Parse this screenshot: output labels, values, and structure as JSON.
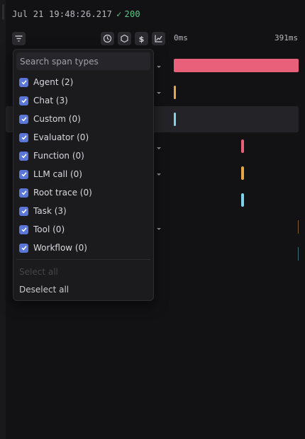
{
  "header": {
    "timestamp": "Jul 21 19:48:26.217",
    "status_check": "✓",
    "status_code": "200"
  },
  "toolbar": {
    "filter_icon": "filter-icon",
    "clock_icon": "clock-icon",
    "hexagon_icon": "hexagon-icon",
    "dollar_icon": "dollar-icon",
    "chart_icon": "chart-icon"
  },
  "timeline": {
    "start_label": "0ms",
    "end_label": "391ms",
    "colors": {
      "agent": "#e8607a",
      "chat": "#e5a643",
      "custom": "#7fd3e8"
    }
  },
  "filter_menu": {
    "search_placeholder": "Search span types",
    "options": [
      {
        "label": "Agent (2)",
        "checked": true
      },
      {
        "label": "Chat (3)",
        "checked": true
      },
      {
        "label": "Custom (0)",
        "checked": true
      },
      {
        "label": "Evaluator (0)",
        "checked": true
      },
      {
        "label": "Function (0)",
        "checked": true
      },
      {
        "label": "LLM call (0)",
        "checked": true
      },
      {
        "label": "Root trace (0)",
        "checked": true
      },
      {
        "label": "Task (3)",
        "checked": true
      },
      {
        "label": "Tool (0)",
        "checked": true
      },
      {
        "label": "Workflow (0)",
        "checked": true
      }
    ],
    "select_all_label": "Select all",
    "deselect_all_label": "Deselect all"
  }
}
